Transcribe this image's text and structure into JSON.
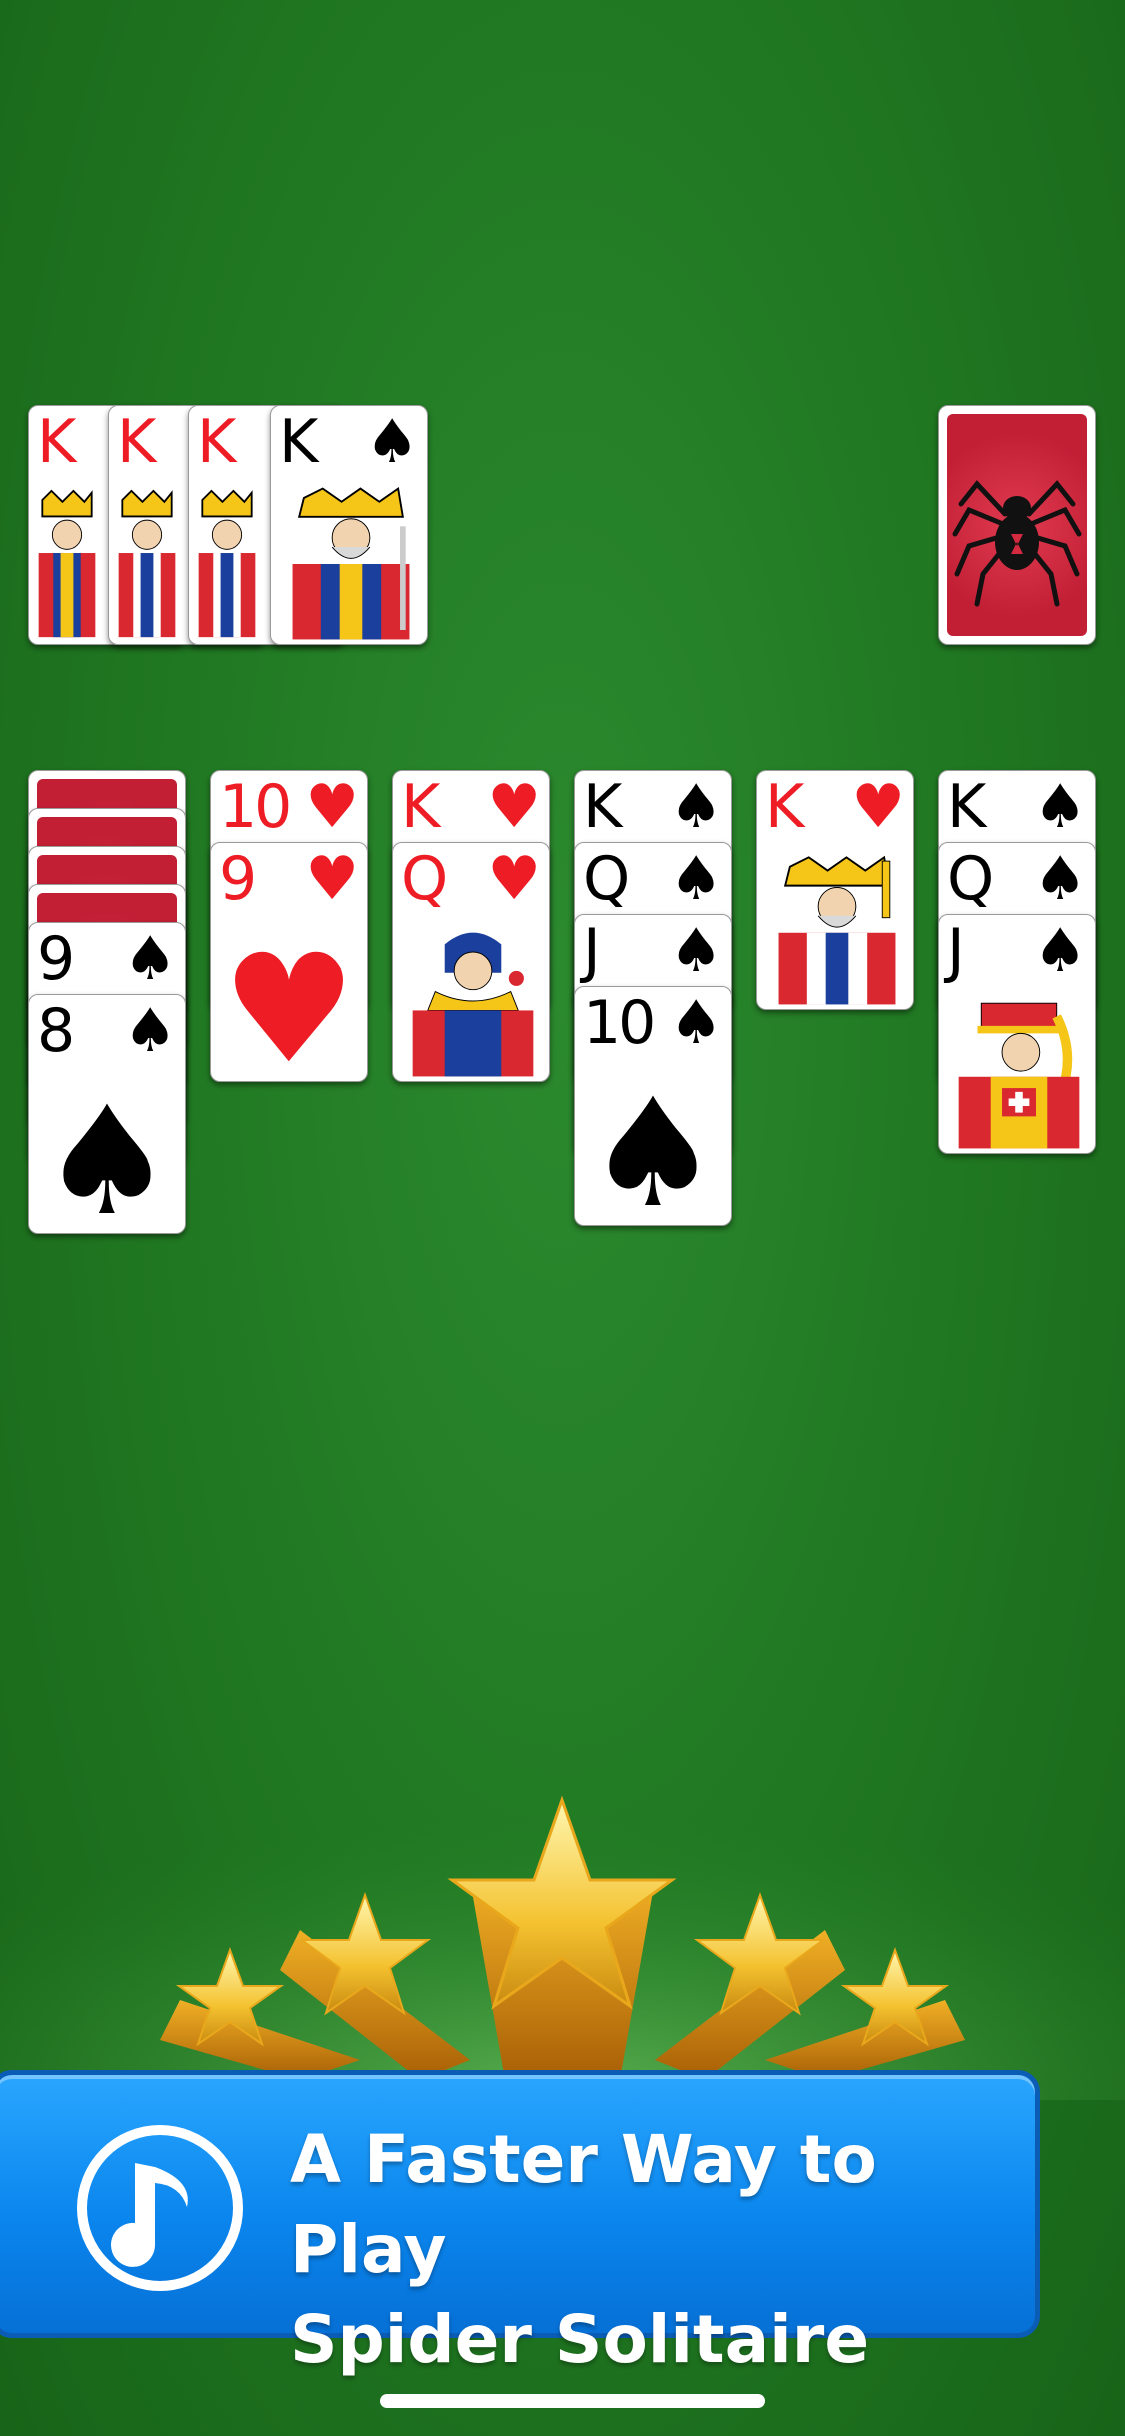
{
  "foundation": [
    {
      "rank": "K",
      "suit": "♥",
      "color": "red"
    },
    {
      "rank": "K",
      "suit": "♥",
      "color": "red"
    },
    {
      "rank": "K",
      "suit": "♥",
      "color": "red"
    },
    {
      "rank": "K",
      "suit": "♠",
      "color": "black"
    }
  ],
  "stock": {
    "cards_remaining_visible": 1,
    "icon": "spider-icon"
  },
  "tableau": [
    {
      "face_down": 4,
      "cards": [
        {
          "rank": "9",
          "suit": "♠"
        },
        {
          "rank": "8",
          "suit": "♠"
        }
      ]
    },
    {
      "face_down": 0,
      "cards": [
        {
          "rank": "10",
          "suit": "♥"
        },
        {
          "rank": "9",
          "suit": "♥"
        }
      ]
    },
    {
      "face_down": 0,
      "cards": [
        {
          "rank": "K",
          "suit": "♥"
        },
        {
          "rank": "Q",
          "suit": "♥"
        }
      ]
    },
    {
      "face_down": 0,
      "cards": [
        {
          "rank": "K",
          "suit": "♠"
        },
        {
          "rank": "Q",
          "suit": "♠"
        },
        {
          "rank": "J",
          "suit": "♠"
        },
        {
          "rank": "10",
          "suit": "♠"
        }
      ]
    },
    {
      "face_down": 0,
      "cards": [
        {
          "rank": "K",
          "suit": "♥"
        }
      ]
    },
    {
      "face_down": 0,
      "cards": [
        {
          "rank": "K",
          "suit": "♠"
        },
        {
          "rank": "Q",
          "suit": "♠"
        },
        {
          "rank": "J",
          "suit": "♠"
        }
      ]
    }
  ],
  "banner": {
    "line1": "A Faster Way to Play",
    "line2": "Spider Solitaire",
    "icon": "music-note-icon"
  },
  "colors": {
    "felt": "#217a23",
    "card_red": "#ee1c24",
    "banner_blue": "#0a86ee",
    "card_back": "#d42a40"
  }
}
